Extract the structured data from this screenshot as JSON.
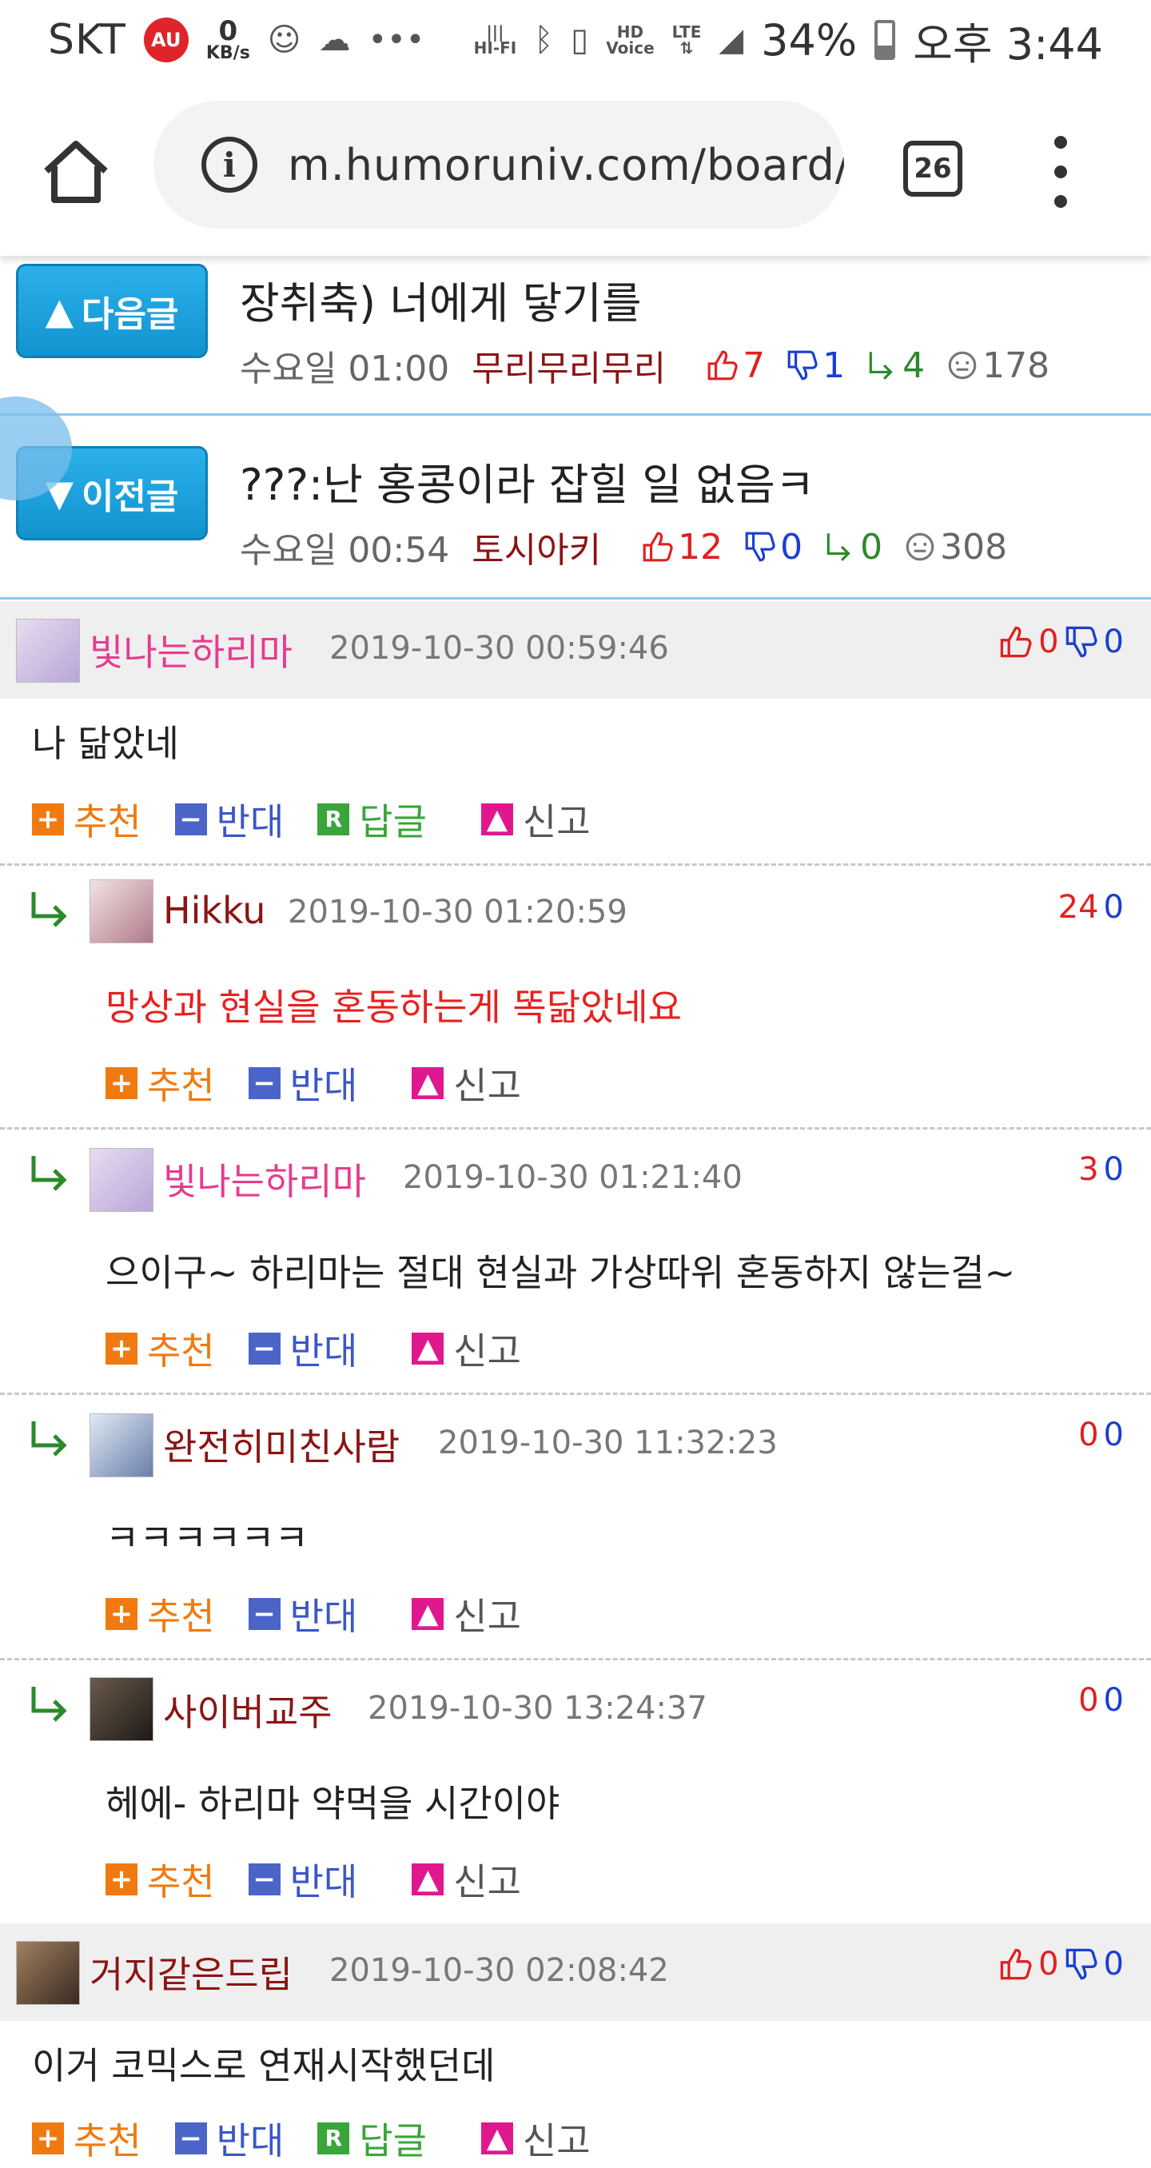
{
  "status_bar": {
    "carrier": "SKT",
    "au_badge": "AU",
    "net_speed_value": "0",
    "net_speed_unit": "KB/s",
    "hifi_label": "HI-FI",
    "hd_label": "HD",
    "voice_label": "Voice",
    "lte_label": "LTE",
    "battery": "34%",
    "time": "오후 3:44"
  },
  "browser": {
    "url": "m.humoruniv.com/board/r",
    "tab_count": "26"
  },
  "next_post": {
    "button_label": "다음글",
    "title": "장취축) 너에게 닿기를",
    "date": "수요일 01:00",
    "author": "무리무리무리",
    "up": "7",
    "down": "1",
    "replies": "4",
    "views": "178"
  },
  "prev_post": {
    "button_label": "이전글",
    "title": "???:난 홍콩이라 잡힐 일 없음ㅋ",
    "date": "수요일 00:54",
    "author": "토시아키",
    "up": "12",
    "down": "0",
    "replies": "0",
    "views": "308"
  },
  "actions": {
    "recommend": "추천",
    "oppose": "반대",
    "reply": "답글",
    "report": "신고"
  },
  "comments": [
    {
      "nick": "빛나는하리마",
      "date": "2019-10-30 00:59:46",
      "up": "0",
      "down": "0",
      "text": "나 닮았네"
    },
    {
      "nick": "Hikku",
      "date": "2019-10-30 01:20:59",
      "up": "24",
      "down": "0",
      "text": "망상과 현실을 혼동하는게 똑닮았네요"
    },
    {
      "nick": "빛나는하리마",
      "date": "2019-10-30 01:21:40",
      "up": "3",
      "down": "0",
      "text": "으이구~ 하리마는 절대 현실과 가상따위 혼동하지 않는걸~"
    },
    {
      "nick": "완전히미친사람",
      "date": "2019-10-30 11:32:23",
      "up": "0",
      "down": "0",
      "text": "ㅋㅋㅋㅋㅋㅋ"
    },
    {
      "nick": "사이버교주",
      "date": "2019-10-30 13:24:37",
      "up": "0",
      "down": "0",
      "text": "헤에- 하리마 약먹을 시간이야"
    },
    {
      "nick": "거지같은드립",
      "date": "2019-10-30 02:08:42",
      "up": "0",
      "down": "0",
      "text": "이거 코믹스로 연재시작했던데"
    }
  ],
  "colors": {
    "nav_button": "#1a9fdc",
    "nick_pink": "#e53c8f",
    "nick_maroon": "#8b1414",
    "upvote": "#e02020",
    "downvote": "#1a3fd0",
    "recommend": "#f07a10",
    "oppose": "#4a64c8",
    "reply": "#3aa53a",
    "report": "#e01890"
  }
}
